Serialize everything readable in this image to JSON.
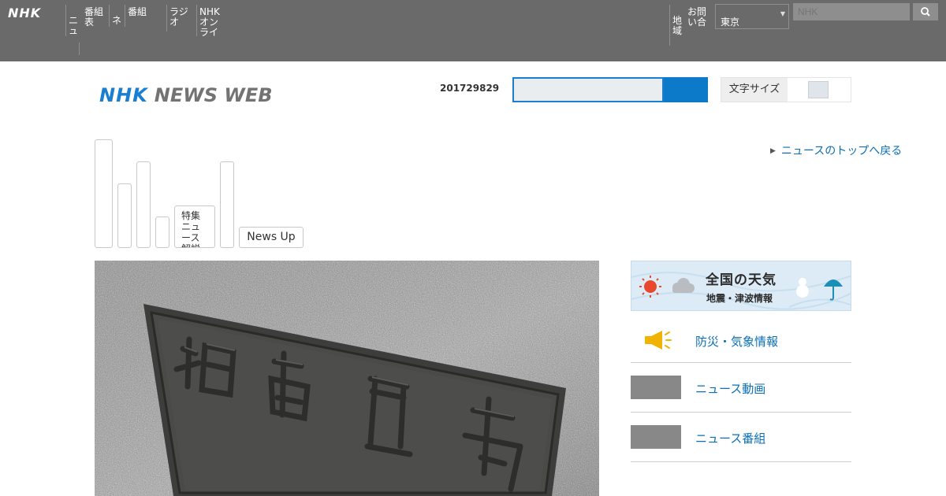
{
  "global_bar": {
    "logo": "NHK",
    "nav_items": [
      "ニュース",
      "番組表",
      "ネット配信",
      "番組",
      "ラジオ",
      "",
      "NHKオンライン"
    ],
    "right_items": [
      "地域",
      "お問い合わせ"
    ],
    "region_select": {
      "selected": "東京"
    },
    "search": {
      "placeholder": "NHK"
    }
  },
  "header": {
    "logo_nhk": "NHK",
    "logo_newsweb": "NEWS WEB",
    "date_text": "201729829",
    "settings_label": "文字サイズ"
  },
  "nav": {
    "tabs": [
      "",
      "",
      "",
      "",
      "特集ニュース解説",
      "",
      "News Up"
    ],
    "top_link": "ニュースのトップへ戻る"
  },
  "weather": {
    "title": "全国の天気",
    "subtitle": "地震・津波情報"
  },
  "sidebar": {
    "items": [
      {
        "label": "防災・気象情報"
      },
      {
        "label": "ニュース動画"
      },
      {
        "label": "ニュース番組"
      }
    ]
  },
  "colors": {
    "global_bar": "#6a6a6a",
    "accent_blue": "#1a7fd0",
    "link_blue": "#0b6fb5"
  }
}
